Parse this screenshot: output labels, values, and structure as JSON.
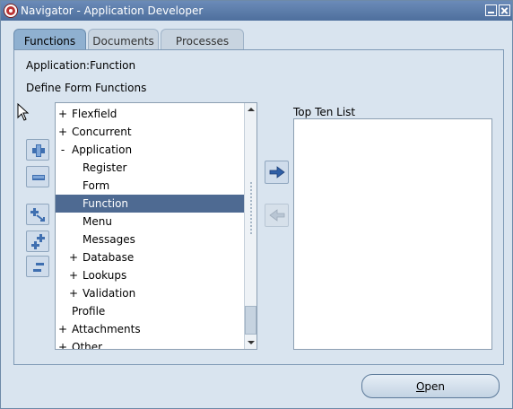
{
  "window": {
    "title": "Navigator - Application Developer"
  },
  "tabs": [
    {
      "label": "Functions",
      "active": true
    },
    {
      "label": "Documents",
      "active": false
    },
    {
      "label": "Processes",
      "active": false
    }
  ],
  "main": {
    "app_label": "Application:Function",
    "define_label": "Define Form Functions",
    "top_ten_label": "Top Ten List",
    "open_button_first": "O",
    "open_button_rest": "pen"
  },
  "tree": {
    "items": [
      {
        "toggle": "+",
        "label": "Flexfield",
        "level": 0,
        "selected": false
      },
      {
        "toggle": "+",
        "label": "Concurrent",
        "level": 0,
        "selected": false
      },
      {
        "toggle": "-",
        "label": "Application",
        "level": 0,
        "selected": false
      },
      {
        "toggle": "",
        "label": "Register",
        "level": 1,
        "selected": false
      },
      {
        "toggle": "",
        "label": "Form",
        "level": 1,
        "selected": false
      },
      {
        "toggle": "",
        "label": "Function",
        "level": 1,
        "selected": true
      },
      {
        "toggle": "",
        "label": "Menu",
        "level": 1,
        "selected": false
      },
      {
        "toggle": "",
        "label": "Messages",
        "level": 1,
        "selected": false
      },
      {
        "toggle": "+",
        "label": "Database",
        "level": 1,
        "selected": false
      },
      {
        "toggle": "+",
        "label": "Lookups",
        "level": 1,
        "selected": false
      },
      {
        "toggle": "+",
        "label": "Validation",
        "level": 1,
        "selected": false
      },
      {
        "toggle": "",
        "label": "Profile",
        "level": 0,
        "selected": false
      },
      {
        "toggle": "+",
        "label": "Attachments",
        "level": 0,
        "selected": false
      },
      {
        "toggle": "+",
        "label": "Other",
        "level": 0,
        "selected": false
      }
    ]
  },
  "icons": {
    "app": "oracle-logo-icon",
    "minimize": "minimize-icon",
    "close": "close-icon",
    "expand": "expand-icon",
    "collapse": "collapse-icon",
    "expand_branch": "expand-branch-icon",
    "expand_all": "expand-all-icon",
    "collapse_all": "collapse-all-icon",
    "move_right": "arrow-right-icon",
    "move_left": "arrow-left-icon"
  },
  "colors": {
    "titlebar": "#5a7aa8",
    "selection": "#4e6a92",
    "background": "#d9e4ef"
  }
}
